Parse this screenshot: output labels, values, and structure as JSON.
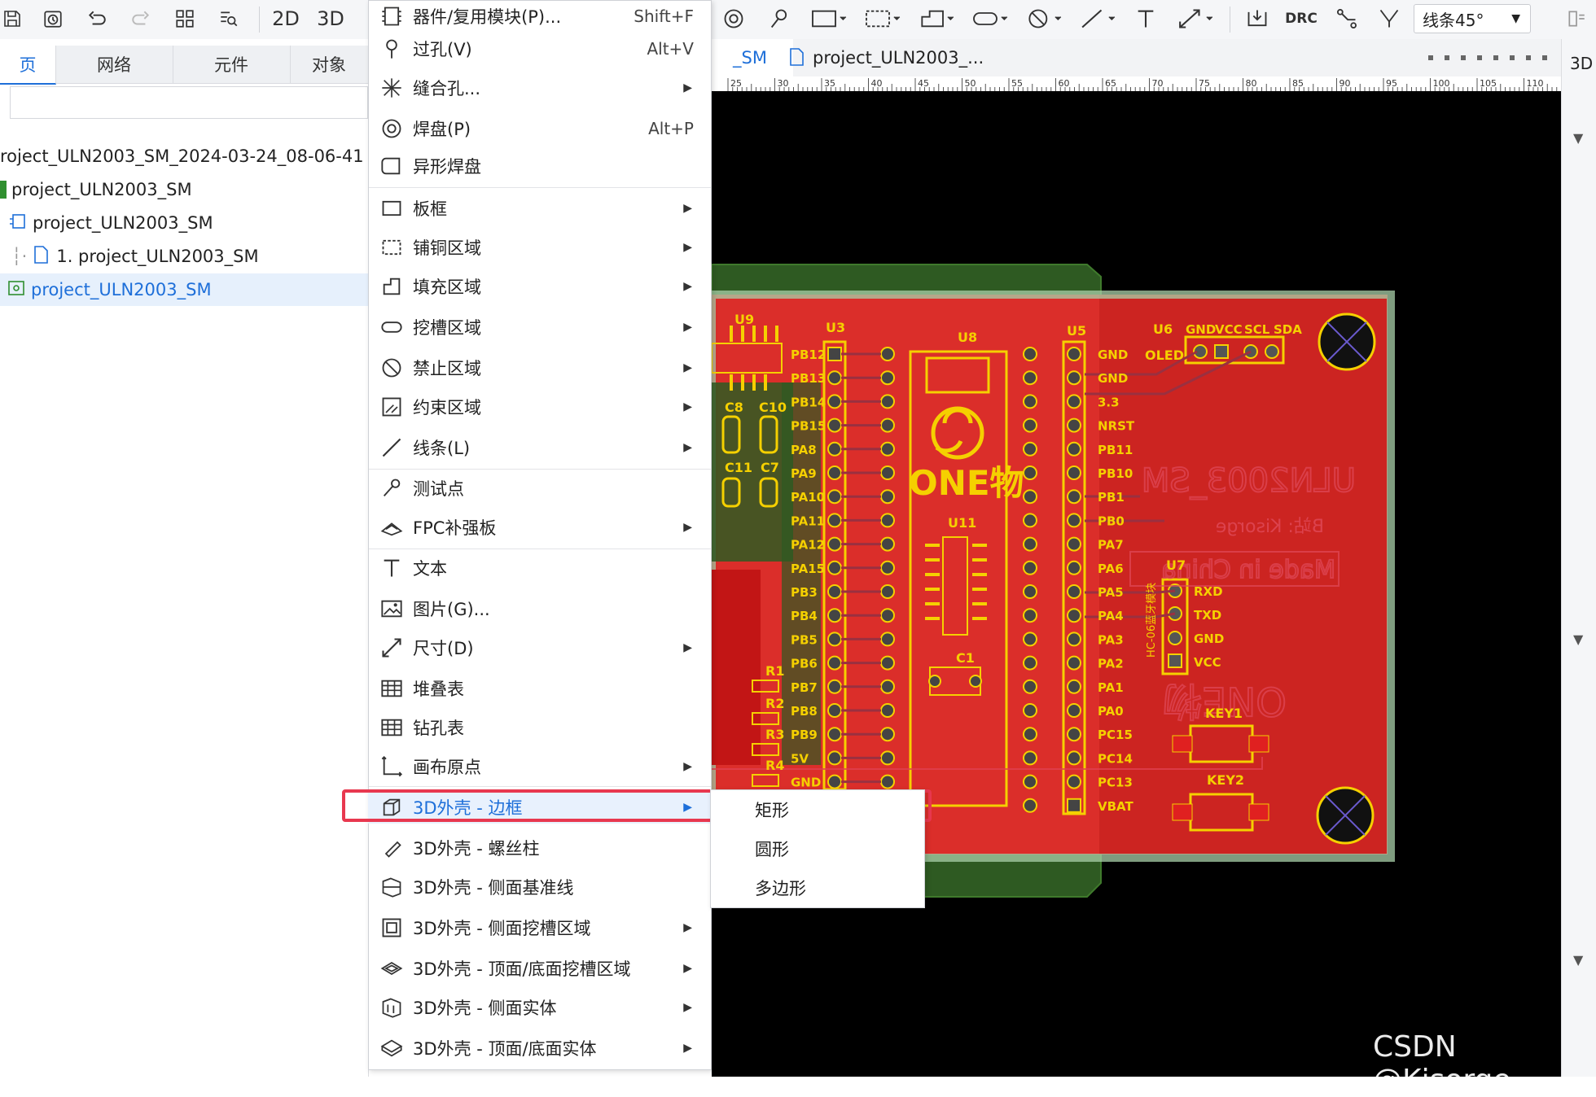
{
  "toolbar": {
    "btn_2d": "2D",
    "btn_3d": "3D",
    "btn_drc": "DRC",
    "line_style": "线条45°"
  },
  "left_panel": {
    "tabs": [
      "页",
      "网络",
      "元件",
      "对象"
    ],
    "tree": [
      {
        "label": "roject_ULN2003_SM_2024-03-24_08-06-41"
      },
      {
        "label": "project_ULN2003_SM"
      },
      {
        "label": "project_ULN2003_SM"
      },
      {
        "label": "1. project_ULN2003_SM"
      },
      {
        "label": "project_ULN2003_SM",
        "selected": true
      }
    ]
  },
  "doc_tabs": [
    {
      "label": "_SM",
      "active": true
    },
    {
      "label": "project_ULN2003_..."
    }
  ],
  "right_panel": {
    "label": "3D"
  },
  "ruler_ticks": [
    "25",
    "30",
    "35",
    "40",
    "45",
    "50",
    "55",
    "60",
    "65",
    "70",
    "75",
    "80",
    "85",
    "90",
    "95",
    "100",
    "105",
    "110"
  ],
  "menu": {
    "items": [
      {
        "label": "器件/复用模块(P)...",
        "shortcut": "Shift+F",
        "icon": "device-icon"
      },
      {
        "label": "过孔(V)",
        "shortcut": "Alt+V",
        "icon": "via-icon"
      },
      {
        "label": "缝合孔...",
        "submenu": true,
        "icon": "stitch-icon"
      },
      {
        "label": "焊盘(P)",
        "shortcut": "Alt+P",
        "icon": "pad-icon"
      },
      {
        "label": "异形焊盘",
        "icon": "custom-pad-icon"
      },
      {
        "label": "板框",
        "submenu": true,
        "icon": "board-outline-icon"
      },
      {
        "label": "铺铜区域",
        "submenu": true,
        "icon": "copper-area-icon"
      },
      {
        "label": "填充区域",
        "submenu": true,
        "icon": "fill-area-icon"
      },
      {
        "label": "挖槽区域",
        "submenu": true,
        "icon": "slot-area-icon"
      },
      {
        "label": "禁止区域",
        "submenu": true,
        "icon": "keepout-icon"
      },
      {
        "label": "约束区域",
        "submenu": true,
        "icon": "constraint-icon"
      },
      {
        "label": "线条(L)",
        "submenu": true,
        "icon": "line-icon"
      },
      {
        "label": "测试点",
        "icon": "test-point-icon"
      },
      {
        "label": "FPC补强板",
        "submenu": true,
        "icon": "fpc-icon"
      },
      {
        "label": "文本",
        "icon": "text-icon"
      },
      {
        "label": "图片(G)...",
        "icon": "image-icon"
      },
      {
        "label": "尺寸(D)",
        "submenu": true,
        "icon": "dimension-icon"
      },
      {
        "label": "堆叠表",
        "icon": "stackup-table-icon"
      },
      {
        "label": "钻孔表",
        "icon": "drill-table-icon"
      },
      {
        "label": "画布原点",
        "submenu": true,
        "icon": "origin-icon"
      },
      {
        "label": "3D外壳 - 边框",
        "submenu": true,
        "icon": "shell-frame-icon",
        "active": true
      },
      {
        "label": "3D外壳 - 螺丝柱",
        "icon": "screw-post-icon"
      },
      {
        "label": "3D外壳 - 侧面基准线",
        "icon": "side-datum-icon"
      },
      {
        "label": "3D外壳 - 侧面挖槽区域",
        "submenu": true,
        "icon": "side-slot-icon"
      },
      {
        "label": "3D外壳 - 顶面/底面挖槽区域",
        "submenu": true,
        "icon": "top-slot-icon"
      },
      {
        "label": "3D外壳 - 侧面实体",
        "submenu": true,
        "icon": "side-solid-icon"
      },
      {
        "label": "3D外壳 - 顶面/底面实体",
        "submenu": true,
        "icon": "top-solid-icon"
      }
    ]
  },
  "submenu": {
    "items": [
      "矩形",
      "圆形",
      "多边形"
    ]
  },
  "pcb": {
    "title": "ULN2003_SM",
    "author": "B站: Kisorge",
    "made_in": "Made in China",
    "logo": "ONE物",
    "refs": {
      "u9": "U9",
      "u3": "U3",
      "u8": "U8",
      "u5": "U5",
      "u6": "U6",
      "u11": "U11",
      "u7": "U7",
      "c1": "C1",
      "c8": "C8",
      "c10": "C10",
      "c11": "C11",
      "c7": "C7",
      "key1": "KEY1",
      "key2": "KEY2",
      "r1": "R1",
      "r2": "R2",
      "r3": "R3",
      "r4": "R4"
    },
    "u3_pins": [
      "PB12",
      "PB13",
      "PB14",
      "PB15",
      "PA8",
      "PA9",
      "PA10",
      "PA11",
      "PA12",
      "PA15",
      "PB3",
      "PB4",
      "PB5",
      "PB6",
      "PB7",
      "PB8",
      "PB9",
      "5V",
      "GND"
    ],
    "u5_pins": [
      "GND",
      "GND",
      "3.3",
      "NRST",
      "PB11",
      "PB10",
      "PB1",
      "PB0",
      "PA7",
      "PA6",
      "PA5",
      "PA4",
      "PA3",
      "PA2",
      "PA1",
      "PA0",
      "PC15",
      "PC14",
      "PC13",
      "VBAT"
    ],
    "u6_pins": [
      "GND",
      "VCC",
      "SCL",
      "SDA"
    ],
    "u6_label": "OLED",
    "u7_pins": [
      "RXD",
      "TXD",
      "GND",
      "VCC"
    ],
    "u7_label": "HC-06蓝牙模块"
  },
  "watermark": "CSDN @Kisorge"
}
